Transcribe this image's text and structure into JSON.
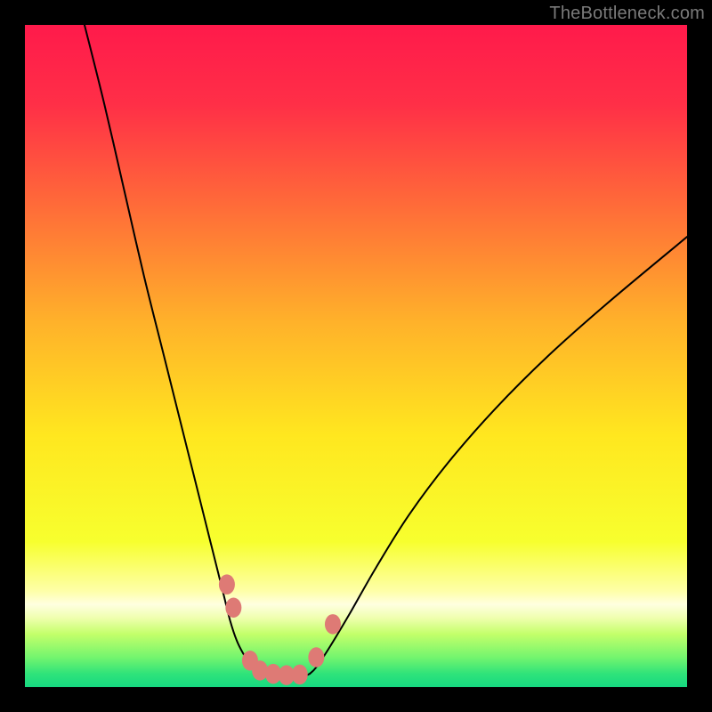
{
  "watermark": "TheBottleneck.com",
  "chart_data": {
    "type": "line",
    "title": "",
    "xlabel": "",
    "ylabel": "",
    "xlim": [
      0,
      100
    ],
    "ylim": [
      0,
      100
    ],
    "grid": false,
    "legend": false,
    "series": [
      {
        "name": "curve-left",
        "x": [
          9,
          12,
          15,
          18,
          21,
          24,
          26,
          28,
          30,
          31,
          32,
          33,
          34,
          35,
          36
        ],
        "y": [
          100,
          88,
          75,
          62,
          50,
          38,
          30,
          22,
          14,
          10,
          7,
          5,
          3.5,
          2.5,
          2
        ],
        "stroke": "#000000",
        "width": 2
      },
      {
        "name": "curve-right",
        "x": [
          43,
          44,
          46,
          49,
          53,
          58,
          64,
          71,
          79,
          88,
          100
        ],
        "y": [
          2,
          3,
          6,
          11,
          18,
          26,
          34,
          42,
          50,
          58,
          68
        ],
        "stroke": "#000000",
        "width": 2
      },
      {
        "name": "floor",
        "x": [
          36,
          38,
          40,
          42,
          43
        ],
        "y": [
          2,
          1.6,
          1.5,
          1.6,
          2
        ],
        "stroke": "#000000",
        "width": 2
      }
    ],
    "markers": [
      {
        "name": "m1",
        "x": 30.5,
        "y": 15.5,
        "r": 9,
        "fill": "#de7a75"
      },
      {
        "name": "m2",
        "x": 31.5,
        "y": 12.0,
        "r": 9,
        "fill": "#de7a75"
      },
      {
        "name": "m3",
        "x": 34.0,
        "y": 4.0,
        "r": 9,
        "fill": "#de7a75"
      },
      {
        "name": "m4",
        "x": 35.5,
        "y": 2.5,
        "r": 9,
        "fill": "#de7a75"
      },
      {
        "name": "m5",
        "x": 37.5,
        "y": 2.0,
        "r": 9,
        "fill": "#de7a75"
      },
      {
        "name": "m6",
        "x": 39.5,
        "y": 1.8,
        "r": 9,
        "fill": "#de7a75"
      },
      {
        "name": "m7",
        "x": 41.5,
        "y": 1.9,
        "r": 9,
        "fill": "#de7a75"
      },
      {
        "name": "m8",
        "x": 44.0,
        "y": 4.5,
        "r": 9,
        "fill": "#de7a75"
      },
      {
        "name": "m9",
        "x": 46.5,
        "y": 9.5,
        "r": 9,
        "fill": "#de7a75"
      }
    ],
    "gradient_stops": [
      {
        "offset": 0.0,
        "color": "#ff1a4b"
      },
      {
        "offset": 0.12,
        "color": "#ff2f47"
      },
      {
        "offset": 0.27,
        "color": "#ff6a39"
      },
      {
        "offset": 0.45,
        "color": "#ffb22a"
      },
      {
        "offset": 0.62,
        "color": "#ffe71f"
      },
      {
        "offset": 0.78,
        "color": "#f7ff2e"
      },
      {
        "offset": 0.855,
        "color": "#feffa8"
      },
      {
        "offset": 0.875,
        "color": "#ffffe0"
      },
      {
        "offset": 0.895,
        "color": "#f0ffb0"
      },
      {
        "offset": 0.92,
        "color": "#c3ff6a"
      },
      {
        "offset": 0.955,
        "color": "#74f56e"
      },
      {
        "offset": 0.98,
        "color": "#2fe37a"
      },
      {
        "offset": 1.0,
        "color": "#16d981"
      }
    ]
  }
}
